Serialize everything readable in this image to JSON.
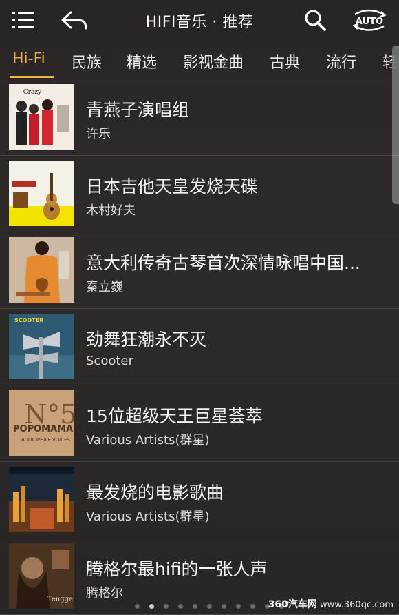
{
  "header": {
    "title": "HIFI音乐 · 推荐",
    "auto_label": "AUTO",
    "icons": [
      "menu-icon",
      "back-icon",
      "search-icon",
      "auto-rotate-icon"
    ]
  },
  "tabs": [
    {
      "label": "Hi-Fi",
      "active": true
    },
    {
      "label": "民族",
      "active": false
    },
    {
      "label": "精选",
      "active": false
    },
    {
      "label": "影视金曲",
      "active": false
    },
    {
      "label": "古典",
      "active": false
    },
    {
      "label": "流行",
      "active": false
    },
    {
      "label": "轻",
      "active": false
    }
  ],
  "list": [
    {
      "title": "青燕子演唱组",
      "artist": "许乐"
    },
    {
      "title": "日本吉他天皇发烧天碟",
      "artist": "木村好夫"
    },
    {
      "title": "意大利传奇古琴首次深情咏唱中国...",
      "artist": "秦立巍"
    },
    {
      "title": "劲舞狂潮永不灭",
      "artist": "Scooter"
    },
    {
      "title": "15位超级天王巨星荟萃",
      "artist": "Various Artists(群星)"
    },
    {
      "title": "最发烧的电影歌曲",
      "artist": "Various Artists(群星)"
    },
    {
      "title": "腾格尔最hifi的一张人声",
      "artist": "腾格尔"
    }
  ],
  "covers": {
    "c1_text": "Crazy",
    "c4_text": "SCOOTER",
    "c5_no": "N°5",
    "c5_text": "POPOMAMA",
    "c5_sub": "AUDIOPHILE VOICES",
    "c7_text": "Tengger"
  },
  "pagination": {
    "count": 11,
    "active": 2
  },
  "watermark": {
    "brand": "360汽车网",
    "url": "www.360qc.com"
  },
  "colors": {
    "accent": "#f0b545",
    "background": "#2b2627"
  }
}
